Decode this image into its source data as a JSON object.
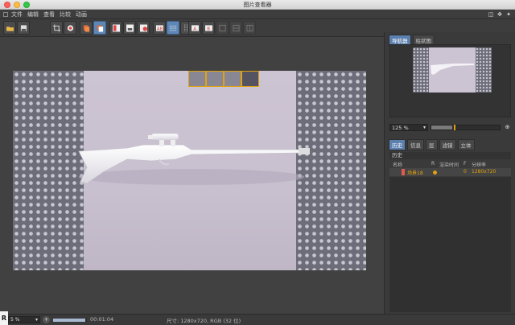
{
  "window": {
    "title": "图片查看器"
  },
  "menu": {
    "items": [
      "文件",
      "编辑",
      "查看",
      "比较",
      "动画"
    ]
  },
  "toolbar": {
    "buttons": [
      {
        "icon": "open-folder-icon"
      },
      {
        "icon": "save-icon"
      },
      {
        "icon": "crop-icon"
      },
      {
        "icon": "record-icon"
      },
      {
        "icon": "layers-a-icon"
      },
      {
        "icon": "layers-b-icon"
      },
      {
        "icon": "compare-a-icon"
      },
      {
        "icon": "compare-b-icon"
      },
      {
        "icon": "compare-c-icon"
      },
      {
        "icon": "ab-icon"
      },
      {
        "icon": "split-a-icon"
      },
      {
        "icon": "split-b-icon"
      },
      {
        "icon": "set-a-icon"
      },
      {
        "icon": "set-b-icon"
      },
      {
        "icon": "dim-a-icon"
      },
      {
        "icon": "dim-b-icon"
      },
      {
        "icon": "dim-c-icon"
      }
    ],
    "labels": {
      "ab": "AB",
      "set_a": "A",
      "set_b": "B"
    }
  },
  "navigator": {
    "tabs": [
      "导航器",
      "柱状图"
    ],
    "zoom_value": "125 %",
    "zoom_fraction": 0.3,
    "zoom_marker_fraction": 0.33
  },
  "history": {
    "tabs": [
      "历史",
      "信息",
      "层",
      "滤镜",
      "立体"
    ],
    "section_title": "历史",
    "columns": {
      "name": "名称",
      "r": "R",
      "render_time": "渲染时间",
      "f": "F",
      "resolution": "分辨率"
    },
    "rows": [
      {
        "name": "场景18",
        "render_time": "",
        "f": "0",
        "resolution": "1280x720"
      }
    ]
  },
  "status": {
    "badge": "R",
    "zoom": "5 %",
    "progress_fraction": 0.95,
    "time": "00:01:04",
    "info": "尺寸: 1280x720, RGB (32 位)"
  },
  "colors": {
    "accent": "#5b7fae",
    "highlight": "#e0a20f",
    "history_swatch": "#e05a50"
  }
}
